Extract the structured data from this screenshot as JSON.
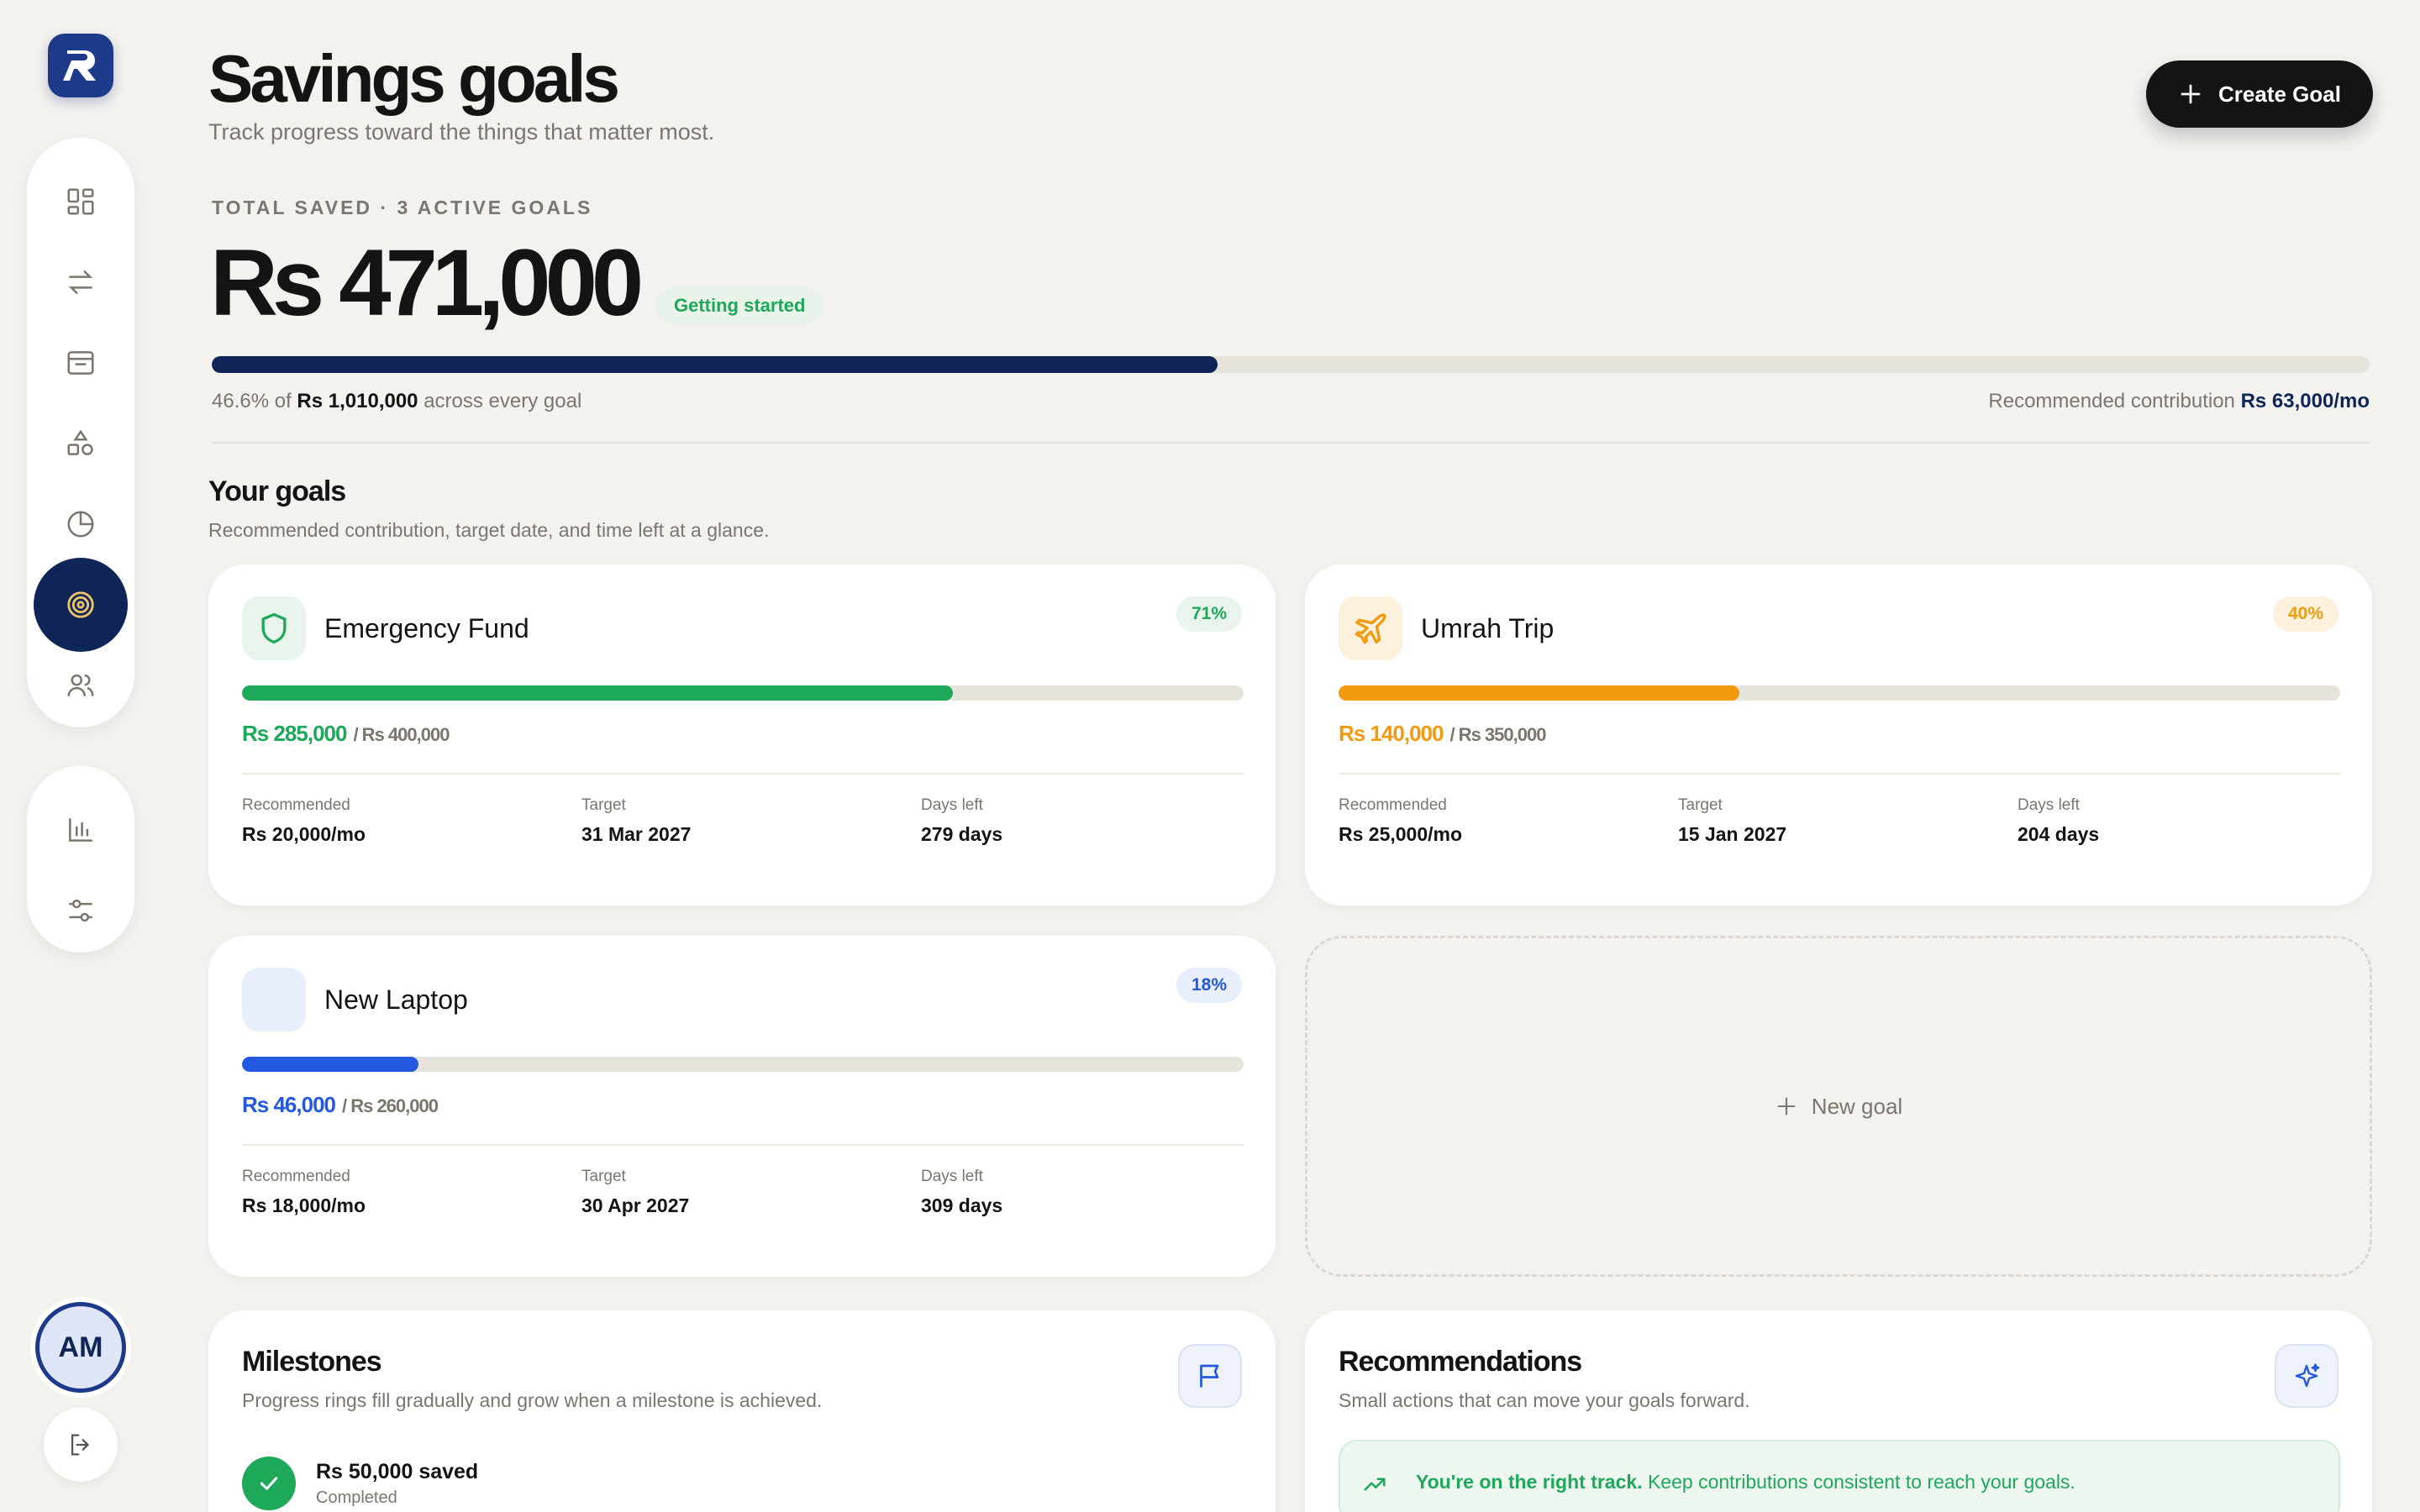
{
  "app": {
    "logo_letter": "R"
  },
  "header": {
    "title": "Savings goals",
    "subtitle": "Track progress toward the things that matter most.",
    "create_button": "Create Goal"
  },
  "summary": {
    "label": "TOTAL SAVED · 3 ACTIVE GOALS",
    "amount": "Rs 471,000",
    "badge": "Getting started",
    "progress": 0.466,
    "caption_pct": "46.6% of",
    "caption_total": "Rs 1,010,000",
    "caption_suffix": "across every goal",
    "rec_label": "Recommended contribution",
    "rec_value": "Rs 63,000/mo"
  },
  "goals_section": {
    "title": "Your goals",
    "subtitle": "Recommended contribution, target date, and time left at a glance."
  },
  "goals": [
    {
      "name": "Emergency Fund",
      "pct": "71%",
      "progress": 0.71,
      "saved": "Rs 285,000",
      "target": "/ Rs 400,000",
      "rec_label": "Recommended",
      "rec": "Rs 20,000/mo",
      "target_label": "Target",
      "target_date": "31 Mar 2027",
      "days_label": "Days left",
      "days": "279 days",
      "color": "#1ea85a",
      "icon_bg": "#e8f4ec",
      "icon": "shield-icon"
    },
    {
      "name": "Umrah Trip",
      "pct": "40%",
      "progress": 0.4,
      "saved": "Rs 140,000",
      "target": "/ Rs 350,000",
      "rec_label": "Recommended",
      "rec": "Rs 25,000/mo",
      "target_label": "Target",
      "target_date": "15 Jan 2027",
      "days_label": "Days left",
      "days": "204 days",
      "color": "#f29a0e",
      "icon_bg": "#fdf0dc",
      "icon": "plane-icon"
    },
    {
      "name": "New Laptop",
      "pct": "18%",
      "progress": 0.176,
      "saved": "Rs 46,000",
      "target": "/ Rs 260,000",
      "rec_label": "Recommended",
      "rec": "Rs 18,000/mo",
      "target_label": "Target",
      "target_date": "30 Apr 2027",
      "days_label": "Days left",
      "days": "309 days",
      "color": "#2458e0",
      "icon_bg": "#e8eefc",
      "icon": "laptop-icon"
    }
  ],
  "new_goal_label": "New goal",
  "milestones": {
    "title": "Milestones",
    "subtitle": "Progress rings fill gradually and grow when a milestone is achieved.",
    "items": [
      {
        "name": "Rs 50,000 saved",
        "status": "Completed"
      }
    ]
  },
  "recommendations": {
    "title": "Recommendations",
    "subtitle": "Small actions that can move your goals forward.",
    "tip_bold": "You're on the right track.",
    "tip_text": "Keep contributions consistent to reach your goals."
  },
  "user": {
    "initials": "AM"
  },
  "colors": {
    "accent": "#0f2557",
    "success": "#1ea85a",
    "warning": "#f29a0e",
    "info": "#2458e0"
  }
}
